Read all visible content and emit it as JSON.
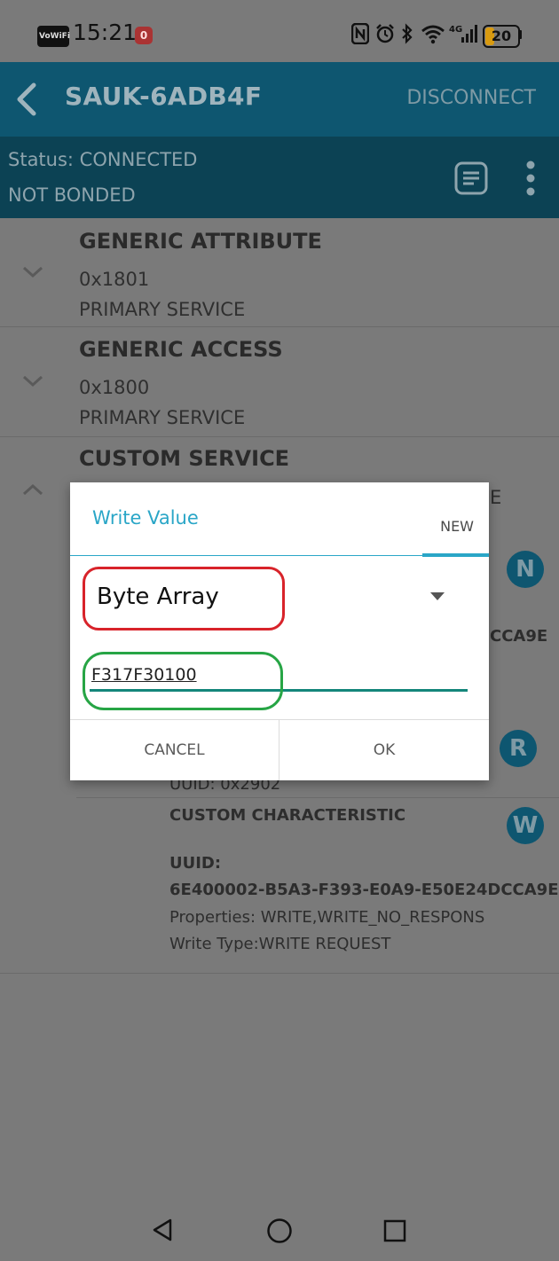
{
  "status_bar": {
    "vowifi": "VoWiFi",
    "time": "15:21",
    "notif": "0",
    "battery": "20",
    "signal_label": "4G"
  },
  "toolbar": {
    "device_name": "SAUK-6ADB4F",
    "disconnect": "DISCONNECT"
  },
  "connection": {
    "status": "Status: CONNECTED",
    "bond": "NOT BONDED"
  },
  "services": [
    {
      "name": "GENERIC ATTRIBUTE",
      "uuid": "0x1801",
      "type": "PRIMARY SERVICE"
    },
    {
      "name": "GENERIC ACCESS",
      "uuid": "0x1800",
      "type": "PRIMARY SERVICE"
    },
    {
      "name": "CUSTOM SERVICE",
      "uuid_partial": "E"
    }
  ],
  "characteristics": {
    "first_partial_uuid": "CCA9E",
    "descriptor_uuid": "UUID: 0x2902",
    "second": {
      "name": "CUSTOM CHARACTERISTIC",
      "uuid_label": "UUID:",
      "uuid": "6E400002-B5A3-F393-E0A9-E50E24DCCA9E",
      "properties": "Properties: WRITE,WRITE_NO_RESPONS",
      "write_type": "Write Type:WRITE REQUEST"
    },
    "buttons": {
      "n": "N",
      "r": "R",
      "w": "W"
    }
  },
  "dialog": {
    "title": "Write Value",
    "tab": "NEW",
    "format_selected": "Byte Array",
    "value": "F317F30100",
    "cancel": "CANCEL",
    "ok": "OK"
  },
  "colors": {
    "toolbar": "#0e5670",
    "accent": "#2aa6c7",
    "annotation_red": "#d8232a",
    "annotation_green": "#27a545"
  }
}
